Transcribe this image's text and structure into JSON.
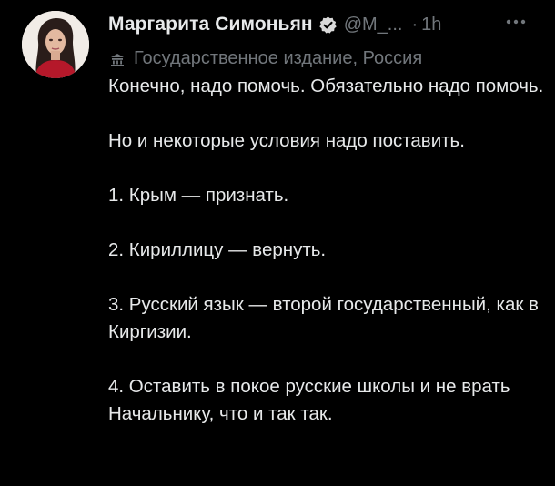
{
  "tweet": {
    "author_name": "Маргарита Симоньян",
    "handle": "@M_...",
    "separator": "·",
    "time": "1h",
    "affiliation": "Государственное издание, Россия",
    "paragraphs": [
      "Конечно, надо помочь. Обязательно надо помочь.",
      "Но и некоторые условия надо поставить.",
      "1. Крым — признать.",
      "2. Кириллицу — вернуть.",
      "3. Русский язык — второй государственный, как в Киргизии.",
      "4. Оставить в покое русские школы и не врать Начальнику, что и так так."
    ]
  },
  "icons": {
    "verified": "verified-badge-icon",
    "affiliation": "state-media-icon",
    "more": "more-options-icon"
  },
  "colors": {
    "background": "#000000",
    "text": "#e7e9ea",
    "secondary": "#71767b"
  }
}
